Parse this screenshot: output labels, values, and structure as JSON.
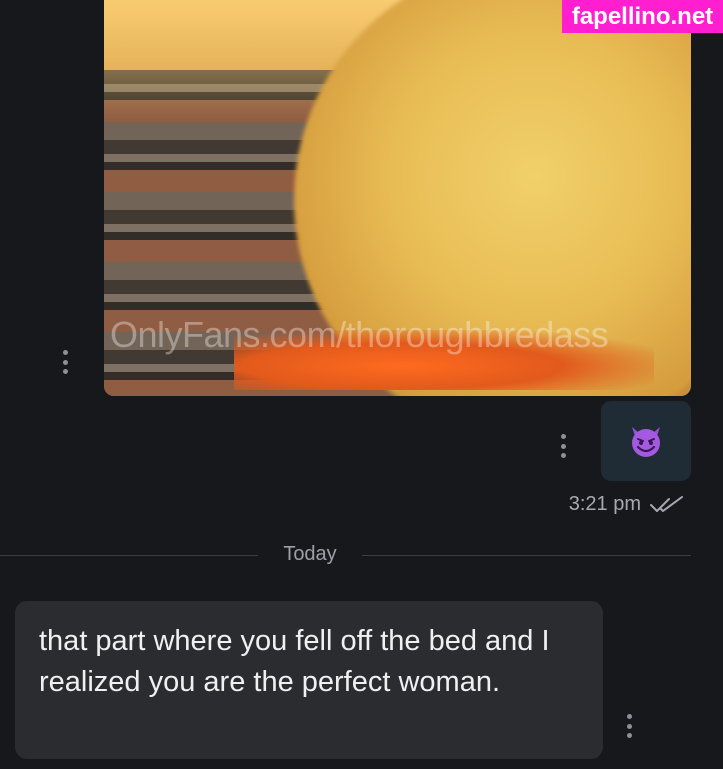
{
  "site_badge": "fapellino.net",
  "media": {
    "watermark": "OnlyFans.com/thoroughbredass"
  },
  "outgoing_emoji": {
    "emoji": "😈",
    "icon": "smiling-face-with-horns-icon"
  },
  "message_meta": {
    "time": "3:21 pm",
    "status_icon": "double-check-icon"
  },
  "date_divider": {
    "label": "Today"
  },
  "incoming_message": {
    "text": "that part where you fell off the bed and I realized you are the perfect woman."
  },
  "colors": {
    "background": "#16181c",
    "incoming_bubble": "#2a2c30",
    "outgoing_bubble": "#1f2c35",
    "badge": "#ff1fd0"
  }
}
